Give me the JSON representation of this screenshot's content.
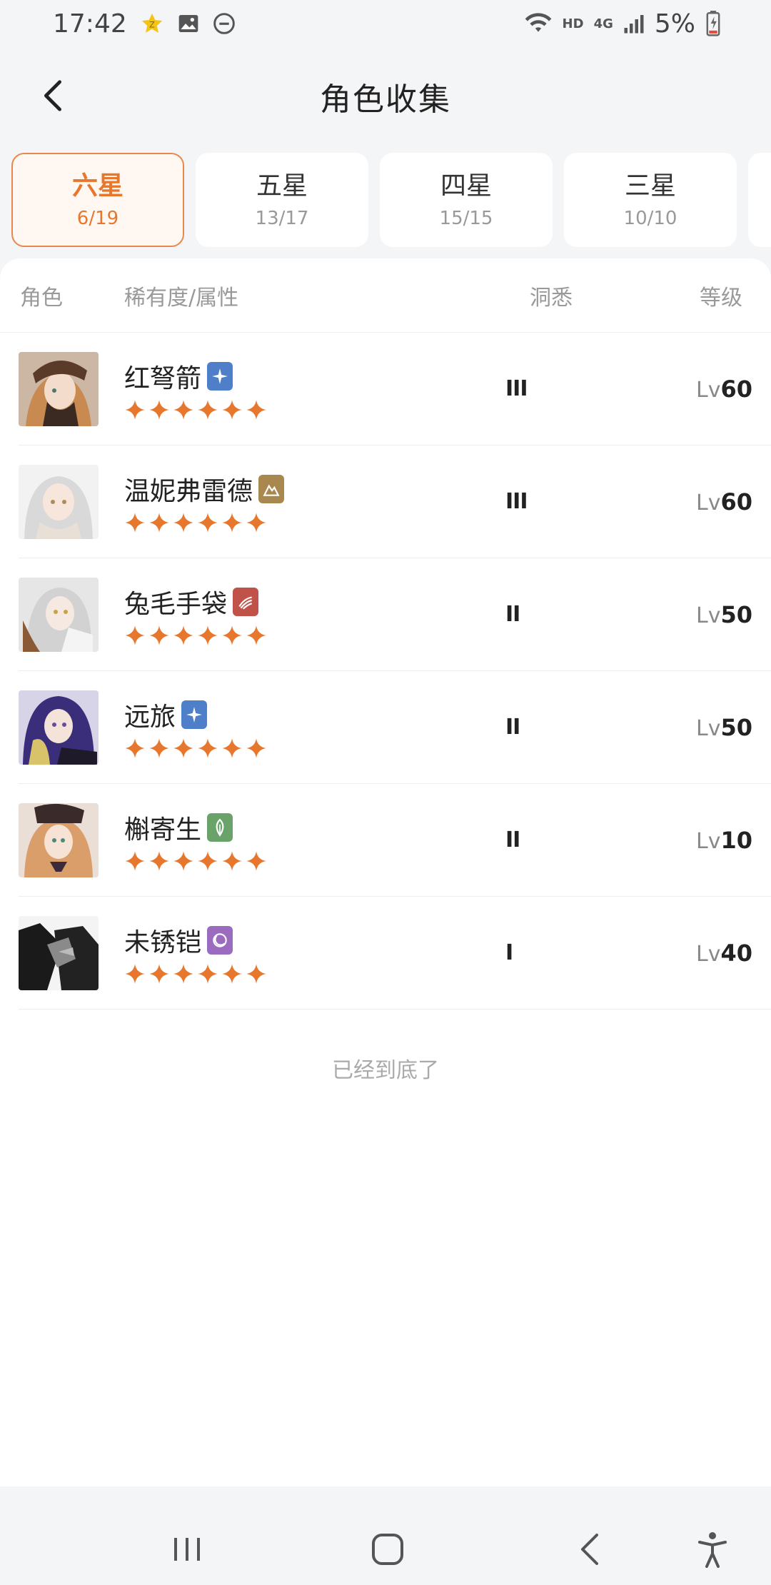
{
  "status": {
    "time": "17:42",
    "battery": "5%",
    "hd": "HD",
    "net": "4G"
  },
  "header": {
    "title": "角色收集"
  },
  "tabs": [
    {
      "label": "六星",
      "count": "6/19",
      "active": true
    },
    {
      "label": "五星",
      "count": "13/17",
      "active": false
    },
    {
      "label": "四星",
      "count": "15/15",
      "active": false
    },
    {
      "label": "三星",
      "count": "10/10",
      "active": false
    }
  ],
  "table": {
    "columns": {
      "role": "角色",
      "rarity": "稀有度/属性",
      "insight": "洞悉",
      "level": "等级"
    },
    "lv_prefix": "Lv",
    "rows": [
      {
        "name": "红弩箭",
        "element": "star-element",
        "element_color": "#4f7fc9",
        "stars": 6,
        "insight": "III",
        "level": "60"
      },
      {
        "name": "温妮弗雷德",
        "element": "mountain-element",
        "element_color": "#a9884f",
        "stars": 6,
        "insight": "III",
        "level": "60"
      },
      {
        "name": "兔毛手袋",
        "element": "beast-element",
        "element_color": "#c0524a",
        "stars": 6,
        "insight": "II",
        "level": "50"
      },
      {
        "name": "远旅",
        "element": "star-element",
        "element_color": "#4f7fc9",
        "stars": 6,
        "insight": "II",
        "level": "50"
      },
      {
        "name": "槲寄生",
        "element": "plant-element",
        "element_color": "#6aa36a",
        "stars": 6,
        "insight": "II",
        "level": "10"
      },
      {
        "name": "未锈铠",
        "element": "spirit-element",
        "element_color": "#9a6bbf",
        "stars": 6,
        "insight": "I",
        "level": "40"
      }
    ]
  },
  "footer_note": "已经到底了",
  "colors": {
    "accent": "#e8772e",
    "star": "#e8772e"
  }
}
